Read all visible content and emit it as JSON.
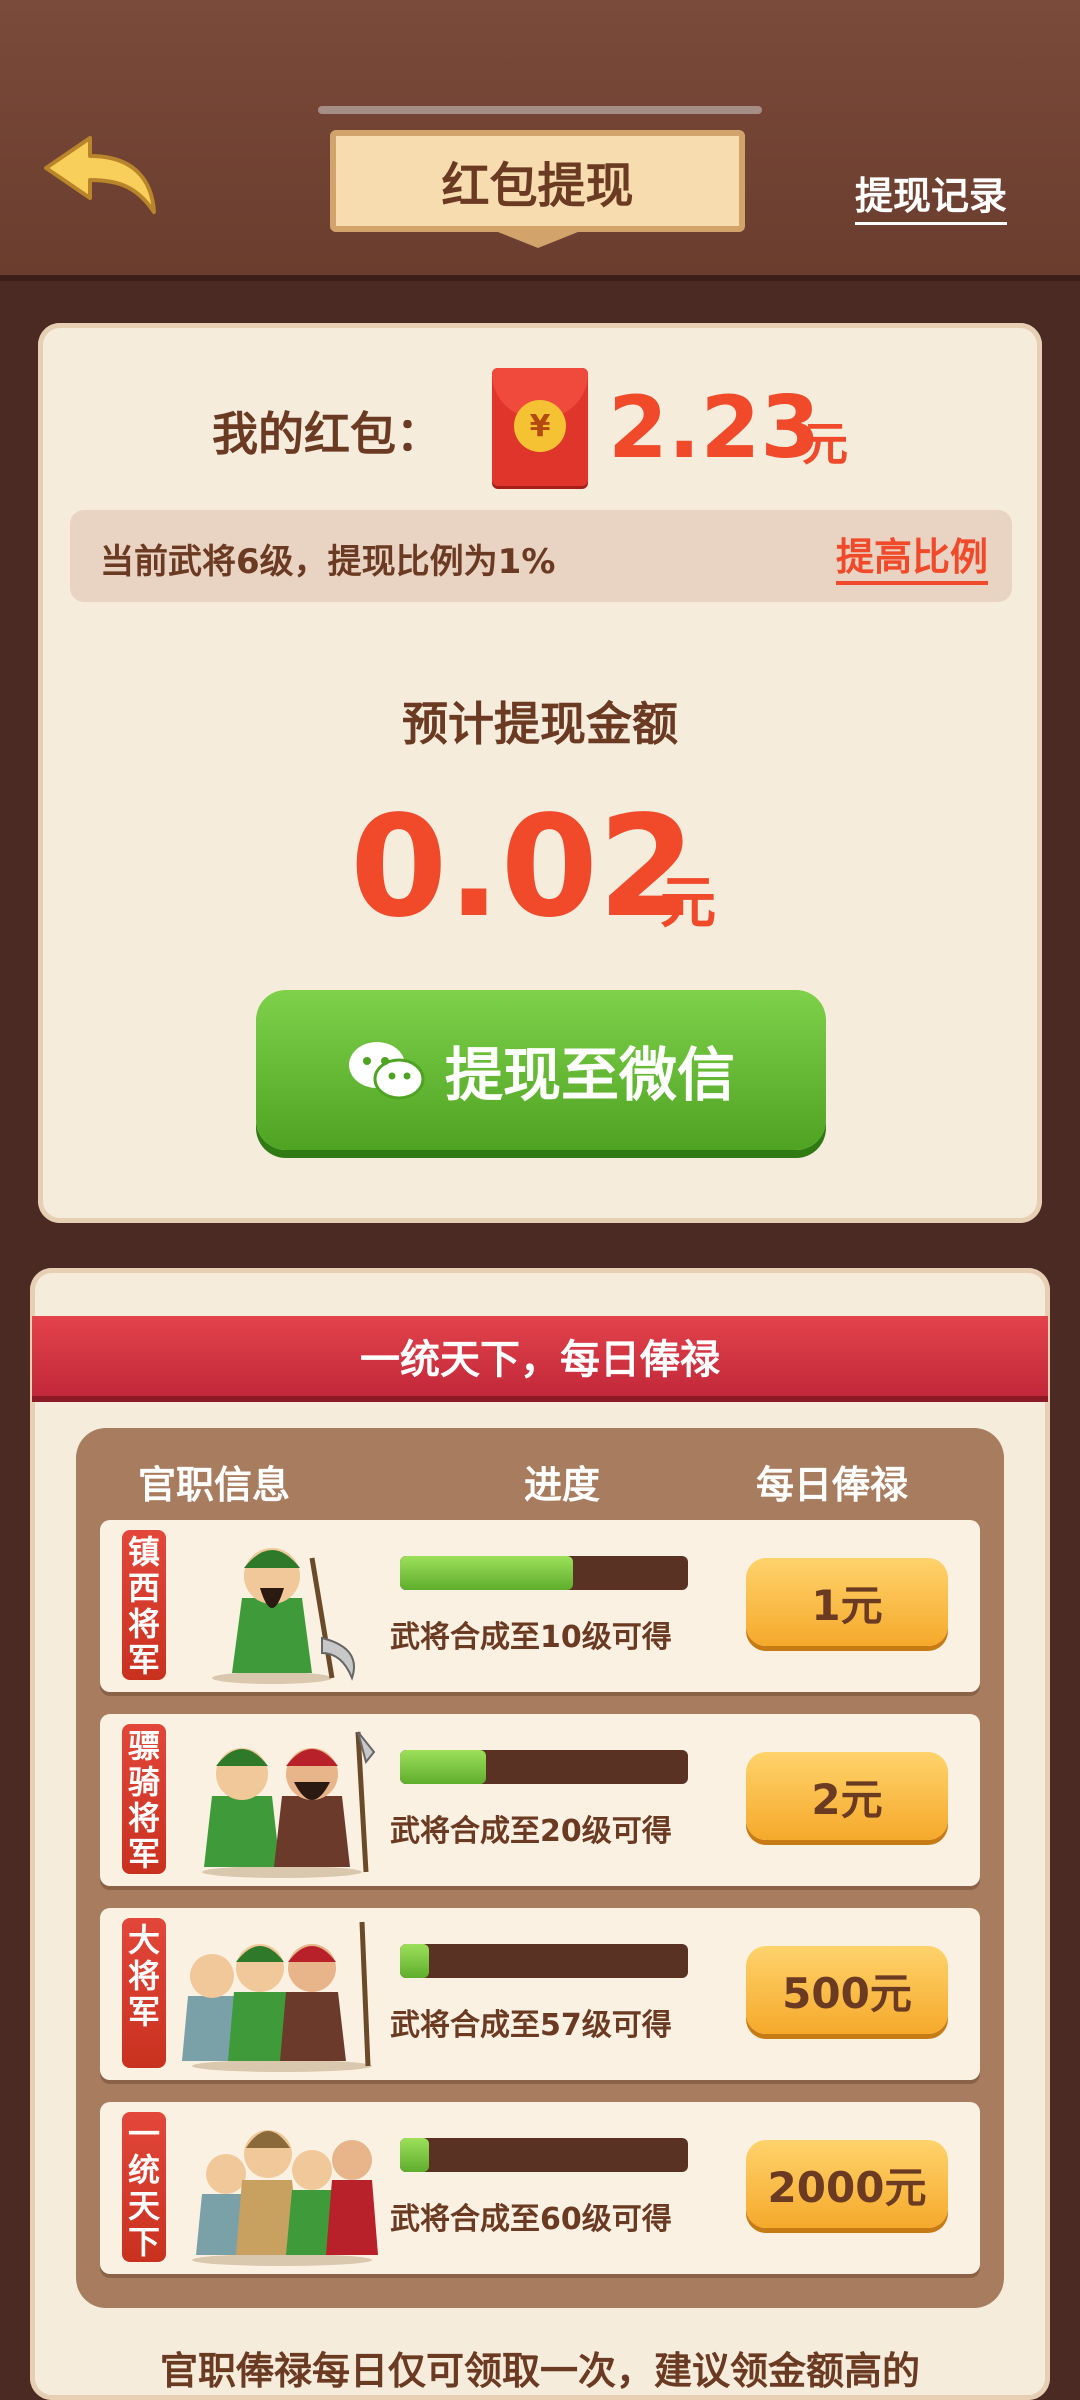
{
  "header": {
    "title": "红包提现",
    "record_link": "提现记录"
  },
  "wallet": {
    "label": "我的红包：",
    "amount": "2.23",
    "unit": "元",
    "ratio_text": "当前武将6级，提现比例为1%",
    "ratio_link": "提高比例"
  },
  "estimate": {
    "label": "预计提现金额",
    "amount": "0.02",
    "unit": "元"
  },
  "withdraw_button": "提现至微信",
  "salary": {
    "ribbon": "一统天下，每日俸禄",
    "headers": [
      "官职信息",
      "进度",
      "每日俸禄"
    ],
    "rows": [
      {
        "rank": "镇西将军",
        "progress": 0.6,
        "condition": "武将合成至10级可得",
        "reward": "1元"
      },
      {
        "rank": "骠骑将军",
        "progress": 0.3,
        "condition": "武将合成至20级可得",
        "reward": "2元"
      },
      {
        "rank": "大将军",
        "progress": 0.1,
        "condition": "武将合成至57级可得",
        "reward": "500元"
      },
      {
        "rank": "一统天下",
        "progress": 0.1,
        "condition": "武将合成至60级可得",
        "reward": "2000元"
      }
    ],
    "footer": "官职俸禄每日仅可领取一次，建议领金额高的"
  },
  "colors": {
    "accent_red": "#f04a2b",
    "button_green": "#5fae2d",
    "brown_text": "#6b3a22"
  }
}
